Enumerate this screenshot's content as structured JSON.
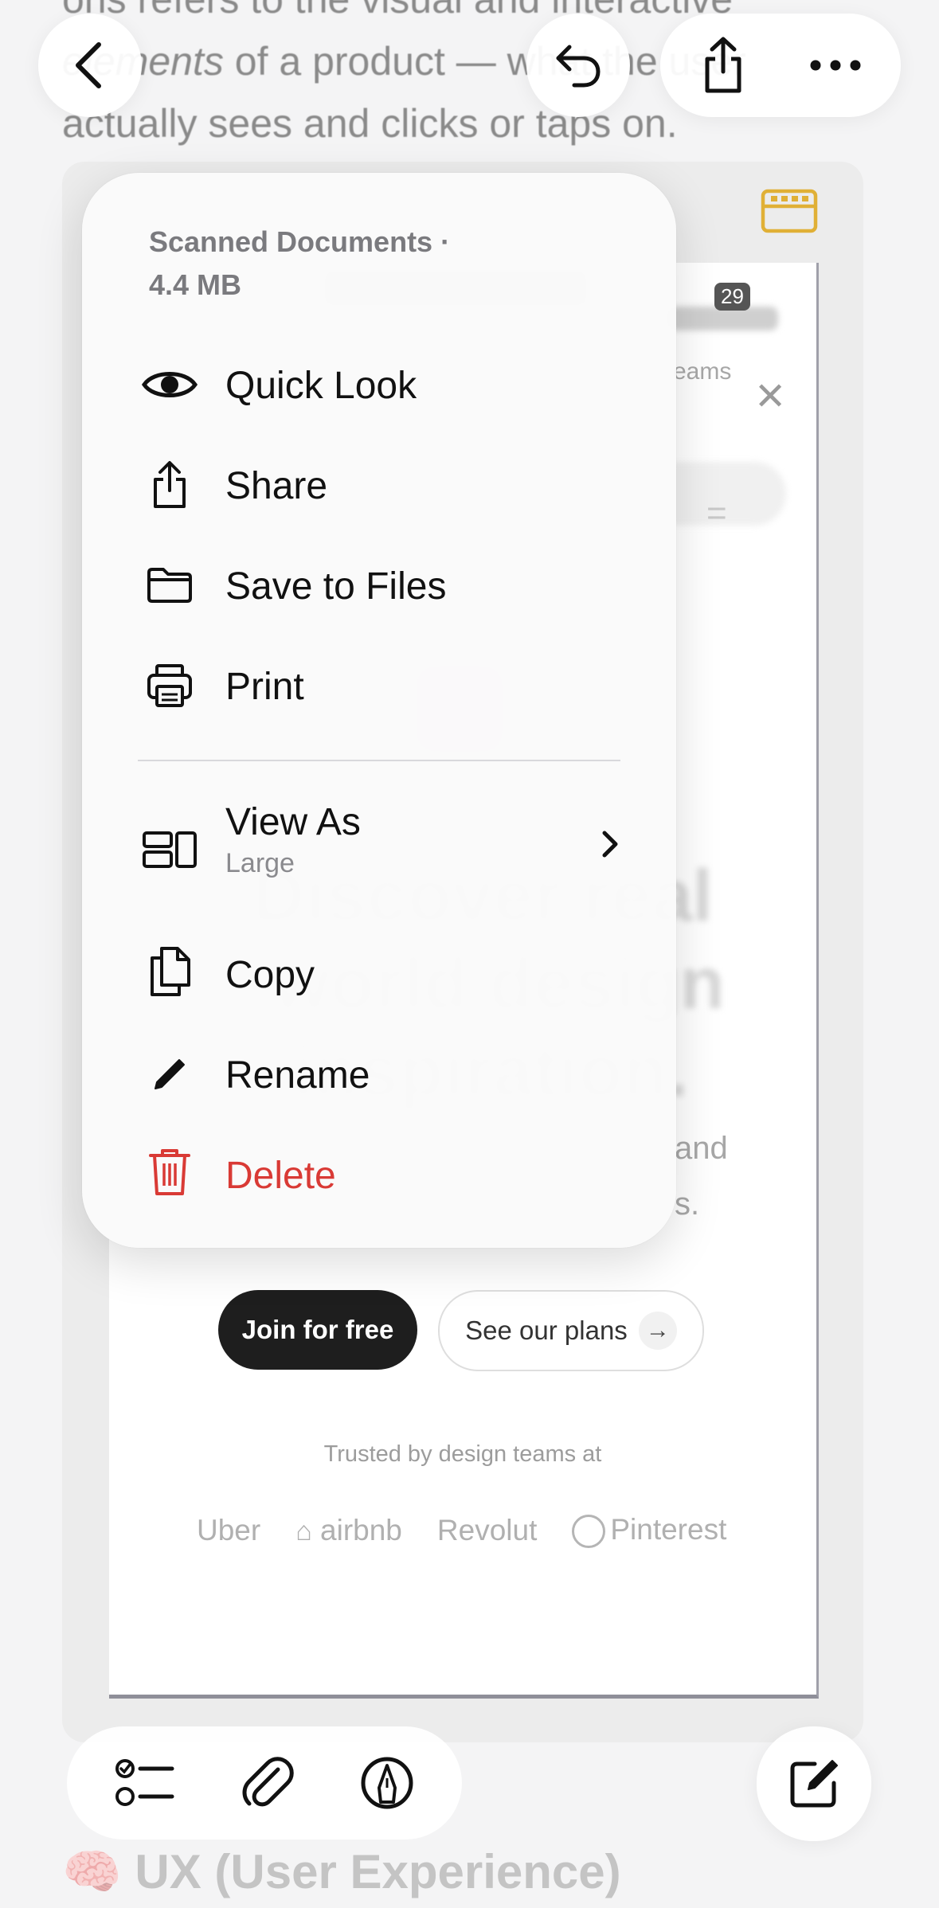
{
  "note": {
    "line1": "ons refers to the visual and interactive",
    "line2_a": "elements",
    "line2_b": " of a product — what the user",
    "line3": "actually sees and clicks or taps on.",
    "next_heading": "UX (User Experience)",
    "next_heading_emoji": "🧠"
  },
  "scan": {
    "tab_fragment": "eams",
    "battery": "29",
    "body_fragment_1": "and",
    "body_fragment_2": "s.",
    "join_label": "Join for free",
    "plans_label": "See our plans",
    "trusted_label": "Trusted by design teams at",
    "logos": [
      "Uber",
      "airbnb",
      "Revolut",
      "Pinterest"
    ]
  },
  "menu": {
    "header_line1": "Scanned Documents ·",
    "header_line2": "4.4 MB",
    "items": [
      {
        "label": "Quick Look",
        "icon": "eye-icon"
      },
      {
        "label": "Share",
        "icon": "share-icon"
      },
      {
        "label": "Save to Files",
        "icon": "folder-icon"
      },
      {
        "label": "Print",
        "icon": "printer-icon"
      },
      {
        "label": "View As",
        "sublabel": "Large",
        "icon": "view-as-icon"
      },
      {
        "label": "Copy",
        "icon": "copy-icon"
      },
      {
        "label": "Rename",
        "icon": "pencil-icon"
      },
      {
        "label": "Delete",
        "icon": "trash-icon"
      }
    ]
  },
  "colors": {
    "danger": "#d93a35",
    "gallery_accent": "#e0b036",
    "menu_bg": "#fafafa"
  }
}
